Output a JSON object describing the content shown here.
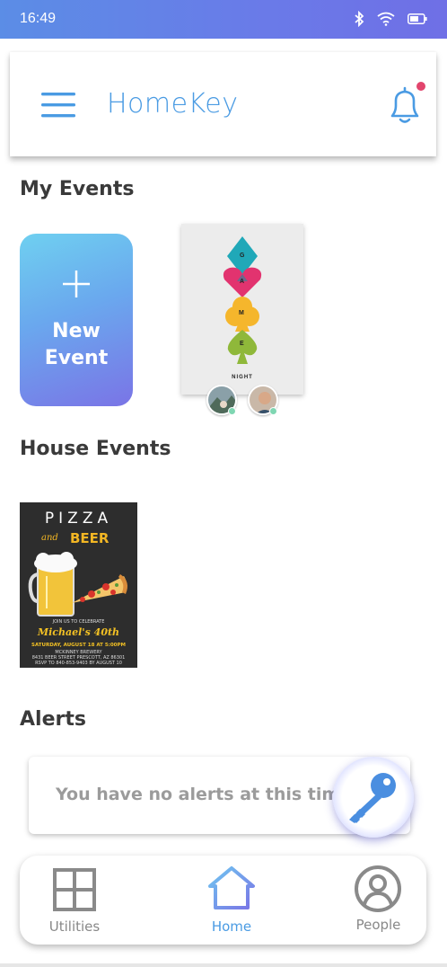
{
  "status_bar": {
    "time": "16:49"
  },
  "header": {
    "app_title": "HomeKey",
    "has_notification": true
  },
  "sections": {
    "my_events": "My Events",
    "house_events": "House Events",
    "alerts": "Alerts"
  },
  "new_event": {
    "label_line1": "New",
    "label_line2": "Event"
  },
  "game_night": {
    "letters": [
      "G",
      "A",
      "M",
      "E"
    ],
    "subtitle": "NIGHT"
  },
  "pizza_flyer": {
    "title": "PIZZA",
    "and": "and",
    "beer": "BEER",
    "join": "JOIN US TO CELEBRATE",
    "name": "Michael's 40th",
    "date": "SATURDAY, AUGUST 18 AT 5:00PM",
    "venue": "MCKINNEY BREWERY",
    "address": "8431 BEER STREET PRESCOTT, AZ 86301",
    "rsvp": "RSVP TO 840-853-9403 BY AUGUST 10"
  },
  "alerts": {
    "empty_message": "You have no alerts at this time"
  },
  "bottom_nav": [
    {
      "label": "Utilities",
      "icon": "grid-icon",
      "active": false
    },
    {
      "label": "Home",
      "icon": "home-icon",
      "active": true
    },
    {
      "label": "People",
      "icon": "person-icon",
      "active": false
    }
  ],
  "colors": {
    "accent": "#4a9be3",
    "status_bar": "#6a7ae8",
    "notification_dot": "#e2456d",
    "inactive_icon": "#8a8a8a"
  }
}
